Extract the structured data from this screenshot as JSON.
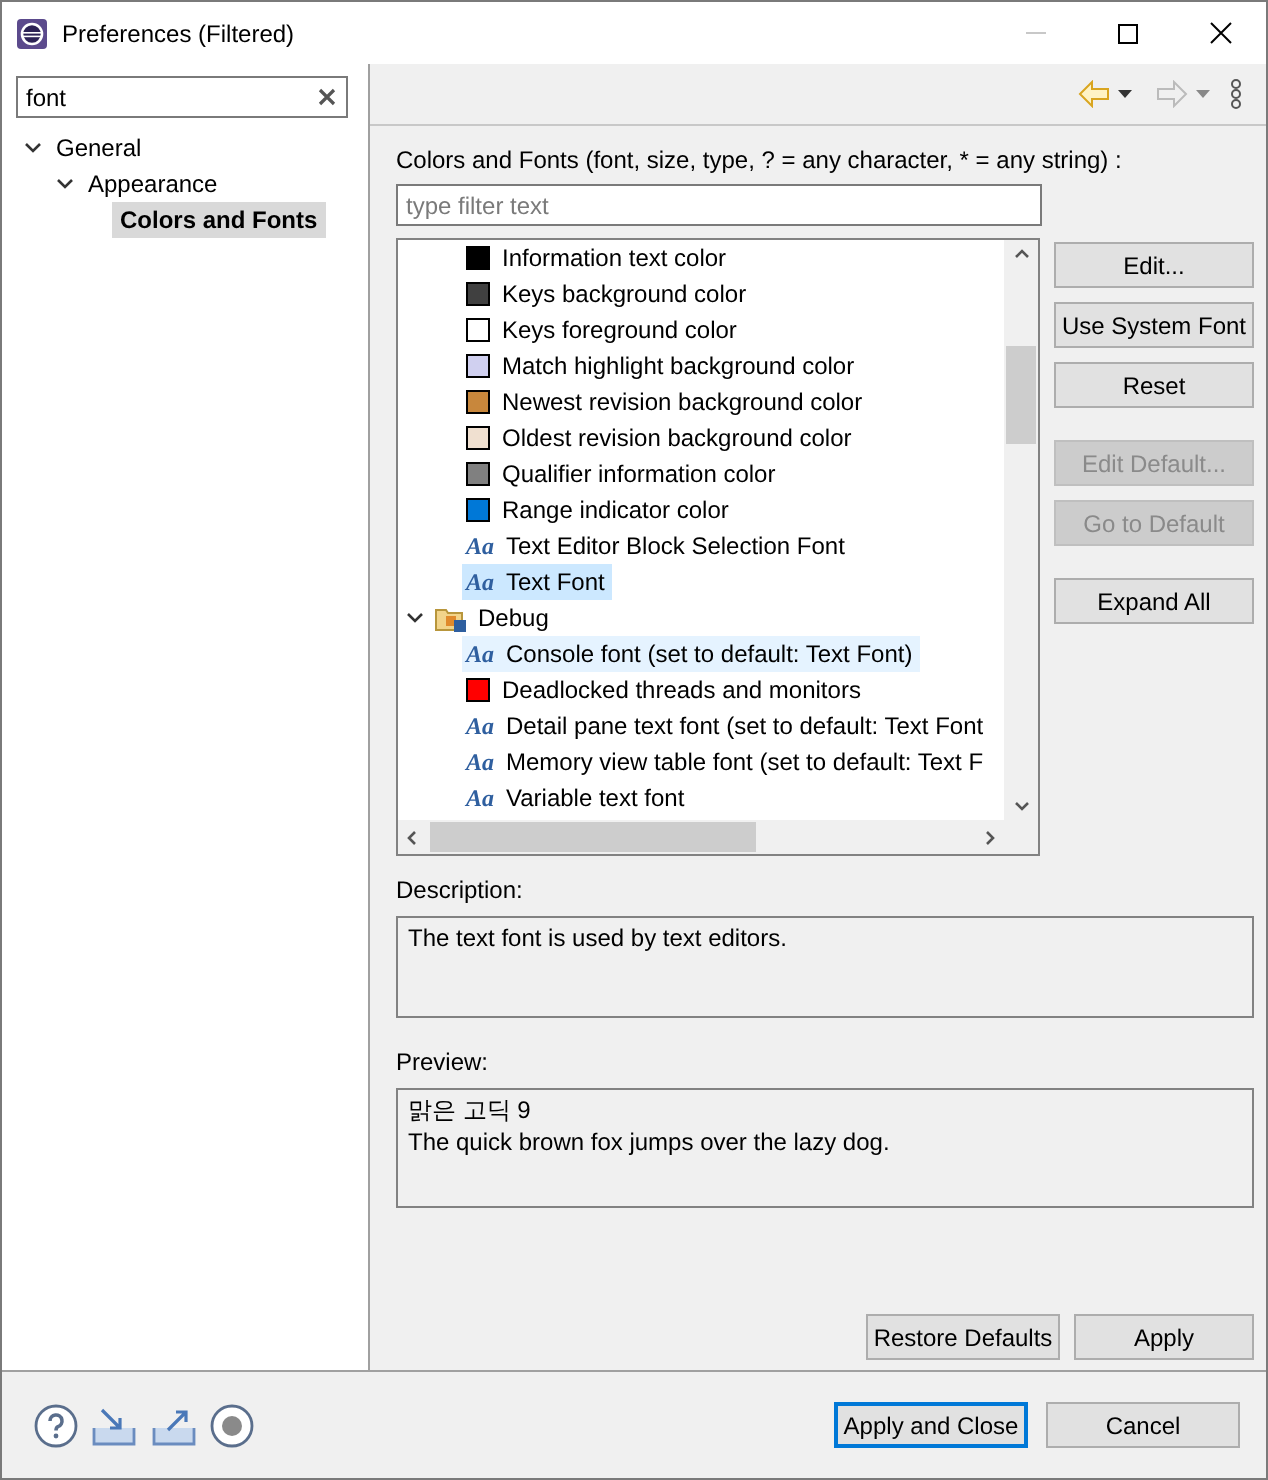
{
  "window": {
    "title": "Preferences (Filtered)"
  },
  "search": {
    "value": "font"
  },
  "nav_tree": [
    {
      "label": "General",
      "expanded": true,
      "selected": false,
      "children": [
        {
          "label": "Appearance",
          "expanded": true,
          "selected": false,
          "children": [
            {
              "label": "Colors and Fonts",
              "selected": true
            }
          ]
        }
      ]
    }
  ],
  "toolbar": {
    "back_disabled": false,
    "forward_disabled": true
  },
  "page": {
    "heading": "Colors and Fonts (font, size, type, ? = any character, * = any string) :",
    "filter": {
      "placeholder": "type filter text"
    },
    "tree": [
      {
        "kind": "group",
        "children": [
          {
            "kind": "color",
            "label": "Information text color",
            "color": "#000000",
            "selected": false,
            "hovered": false
          },
          {
            "kind": "color",
            "label": "Keys background color",
            "color": "#404040",
            "selected": false,
            "hovered": false
          },
          {
            "kind": "color",
            "label": "Keys foreground color",
            "color": "#ffffff",
            "selected": false,
            "hovered": false
          },
          {
            "kind": "color",
            "label": "Match highlight background color",
            "color": "#d0d0f0",
            "selected": false,
            "hovered": false
          },
          {
            "kind": "color",
            "label": "Newest revision background color",
            "color": "#c8873c",
            "selected": false,
            "hovered": false
          },
          {
            "kind": "color",
            "label": "Oldest revision background color",
            "color": "#f0e0d0",
            "selected": false,
            "hovered": false
          },
          {
            "kind": "color",
            "label": "Qualifier information color",
            "color": "#808080",
            "selected": false,
            "hovered": false
          },
          {
            "kind": "color",
            "label": "Range indicator color",
            "color": "#0078d7",
            "selected": false,
            "hovered": false
          },
          {
            "kind": "font",
            "icon": "Aa",
            "label": "Text Editor Block Selection Font",
            "selected": false,
            "hovered": false
          },
          {
            "kind": "font",
            "icon": "Aa",
            "label": "Text Font",
            "selected": true,
            "hovered": false
          }
        ]
      },
      {
        "kind": "category",
        "label": "Debug",
        "expanded": true,
        "children": [
          {
            "kind": "font",
            "icon": "Aa",
            "label": "Console font (set to default: Text Font)",
            "selected": false,
            "hovered": true
          },
          {
            "kind": "color",
            "label": "Deadlocked threads and monitors",
            "color": "#ff0000",
            "selected": false,
            "hovered": false
          },
          {
            "kind": "font",
            "icon": "Aa",
            "label": "Detail pane text font (set to default: Text Font",
            "selected": false,
            "hovered": false
          },
          {
            "kind": "font",
            "icon": "Aa",
            "label": "Memory view table font (set to default: Text F",
            "selected": false,
            "hovered": false
          },
          {
            "kind": "font",
            "icon": "Aa",
            "label": "Variable text font",
            "selected": false,
            "hovered": false
          }
        ]
      }
    ],
    "side_buttons": [
      {
        "label": "Edit...",
        "disabled": false
      },
      {
        "label": "Use System Font",
        "disabled": false
      },
      {
        "label": "Reset",
        "disabled": false
      },
      {
        "label": "Edit Default...",
        "disabled": true
      },
      {
        "label": "Go to Default",
        "disabled": true
      },
      {
        "label": "Expand All",
        "disabled": false
      }
    ],
    "description": {
      "label": "Description:",
      "text": "The text font is used by text editors."
    },
    "preview": {
      "label": "Preview:",
      "lines": [
        "맑은 고딕 9",
        "The quick brown fox jumps over the lazy dog."
      ]
    },
    "page_buttons": [
      "Restore Defaults",
      "Apply"
    ]
  },
  "footer_buttons": [
    {
      "label": "Apply and Close",
      "default": true
    },
    {
      "label": "Cancel",
      "default": false
    }
  ]
}
